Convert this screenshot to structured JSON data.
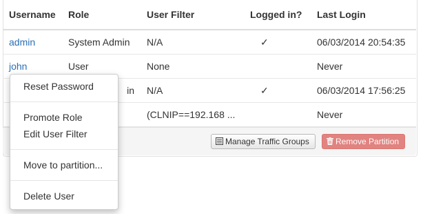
{
  "table": {
    "headers": [
      "Username",
      "Role",
      "User Filter",
      "Logged in?",
      "Last Login"
    ],
    "rows": [
      {
        "username": "admin",
        "role": "System Admin",
        "filter": "N/A",
        "logged_in": "✓",
        "last_login": "06/03/2014 20:54:35"
      },
      {
        "username": "john",
        "role": "User",
        "filter": "None",
        "logged_in": "",
        "last_login": "Never"
      },
      {
        "username": "",
        "role": "in",
        "filter": "N/A",
        "logged_in": "✓",
        "last_login": "06/03/2014 17:56:25"
      },
      {
        "username": "",
        "role": "",
        "filter": "(CLNIP==192.168 ...",
        "logged_in": "",
        "last_login": "Never"
      }
    ]
  },
  "toolbar": {
    "manage_label": "Manage Traffic Groups",
    "remove_label": "Remove Partition",
    "manage_icon": "list-icon",
    "remove_icon": "trash-icon"
  },
  "context_menu": {
    "items": [
      "Reset Password",
      "Promote Role",
      "Edit User Filter",
      "Move to partition...",
      "Delete User"
    ]
  },
  "colors": {
    "link": "#2a6fb5",
    "danger": "#d9534f"
  }
}
